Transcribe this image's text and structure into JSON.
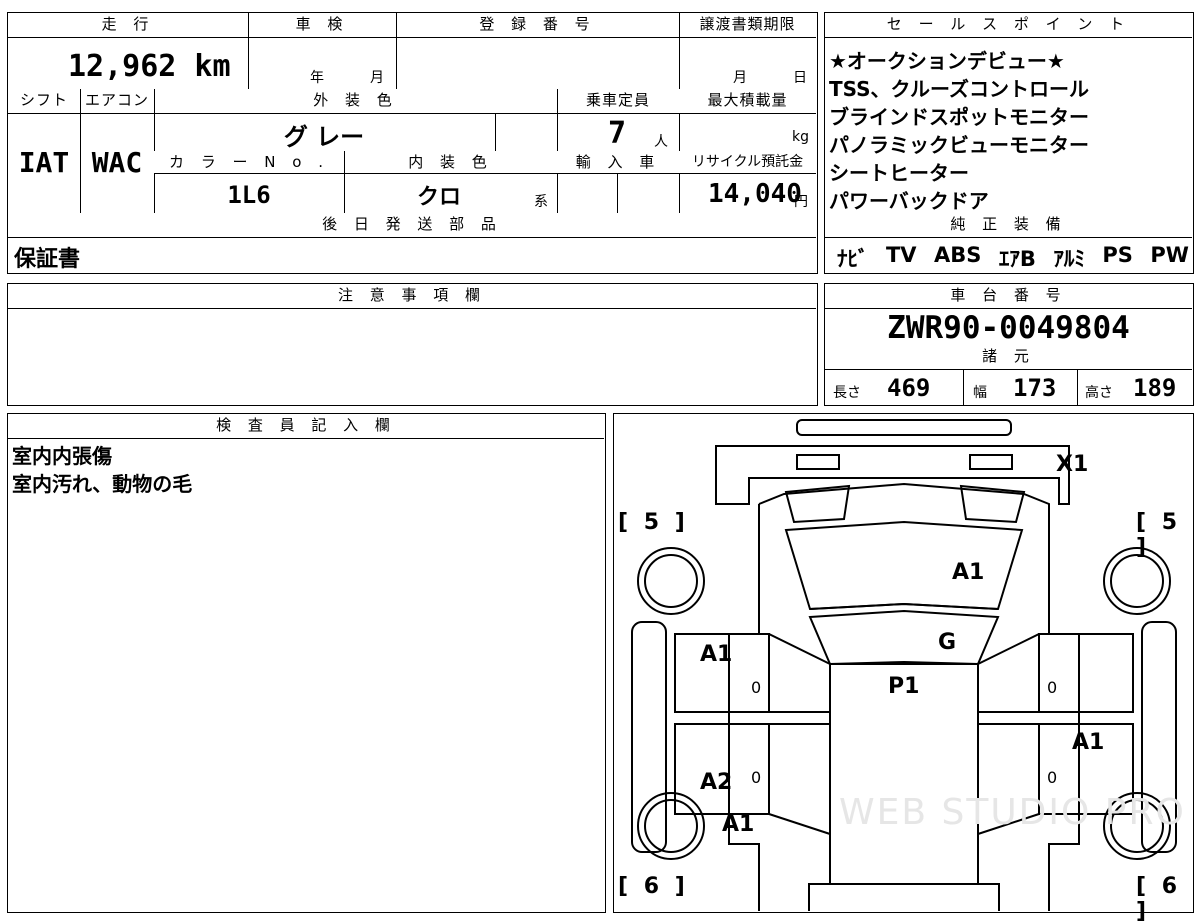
{
  "top": {
    "mileage_label": "走 行",
    "mileage_value": "12,962 km",
    "inspection_label": "車 検",
    "inspection_year": "年",
    "inspection_month": "月",
    "reg_number_label": "登 録 番 号",
    "transfer_label": "譲渡書類期限",
    "transfer_month": "月",
    "transfer_day": "日",
    "shift_label": "シフト",
    "shift_value": "IAT",
    "ac_label": "エアコン",
    "ac_value": "WAC",
    "exterior_color_label": "外 装 色",
    "exterior_color_value": "グ レー",
    "capacity_label": "乗車定員",
    "capacity_value": "7",
    "capacity_unit": "人",
    "max_load_label": "最大積載量",
    "max_load_unit": "kg",
    "color_no_label": "カ ラ ー N o .",
    "color_no_value": "1L6",
    "interior_color_label": "内 装 色",
    "interior_color_value": "クロ",
    "interior_color_suffix": "系",
    "import_label": "輸 入 車",
    "recycle_label": "リサイクル預託金",
    "recycle_value": "14,040",
    "recycle_unit": "円"
  },
  "later_parts": {
    "label": "後 日 発 送 部 品",
    "value": "保証書"
  },
  "sales_points": {
    "label": "セ ー ル ス ポ イ ン ト",
    "items": [
      "★オークションデビュー★",
      "TSS、クルーズコントロール",
      "ブラインドスポットモニター",
      "パノラミックビューモニター",
      "シートヒーター",
      "パワーバックドア"
    ]
  },
  "equipment": {
    "label": "純 正 装 備",
    "items": [
      "ﾅﾋﾞ",
      "TV",
      "ABS",
      "ｴｱB",
      "ｱﾙﾐ",
      "PS",
      "PW"
    ]
  },
  "notes": {
    "label": "注 意 事 項 欄",
    "value": ""
  },
  "chassis": {
    "label": "車 台 番 号",
    "value": "ZWR90-0049804"
  },
  "specs": {
    "label": "諸 元",
    "length_label": "長さ",
    "length_value": "469",
    "width_label": "幅",
    "width_value": "173",
    "height_label": "高さ",
    "height_value": "189"
  },
  "inspector": {
    "label": "検 査 員 記 入 欄",
    "lines": [
      "室内内張傷",
      "室内汚れ、動物の毛"
    ]
  },
  "diagram": {
    "marks": {
      "x1": "X1",
      "a1_hood": "A1",
      "g_windshield": "G",
      "p1_roof": "P1",
      "a1_front_left_door": "A1",
      "a1_rear_right_door": "A1",
      "a2_rear_left_door": "A2",
      "a1_rear_left_panel": "A1",
      "zero_fl": "0",
      "zero_fr": "0",
      "zero_rl": "0",
      "zero_rr": "0"
    },
    "tires": {
      "front_left": "5",
      "front_right": "5",
      "rear_left": "6",
      "rear_right": "6"
    },
    "bracket_open": "[",
    "bracket_close": "]",
    "watermark": "WEB STUDIO PRO"
  }
}
